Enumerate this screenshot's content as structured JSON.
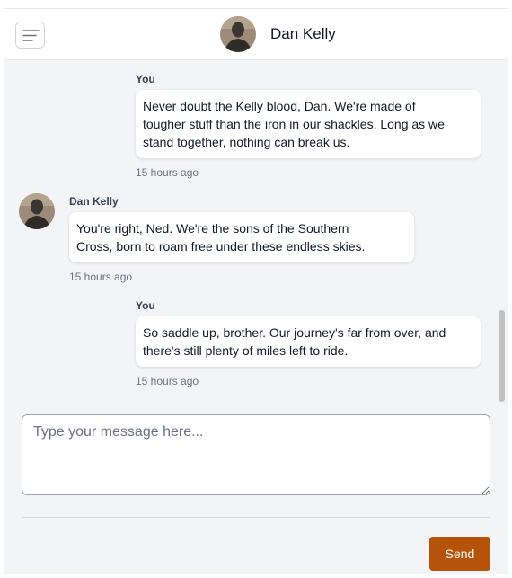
{
  "header": {
    "menu_icon": "menu-icon",
    "contact_name": "Dan Kelly"
  },
  "messages": [
    {
      "sender": "You",
      "text_lines": [
        "Never doubt the Kelly blood, Dan. We're made of",
        "tougher stuff than the iron in our shackles. Long as we",
        "stand together, nothing can break us."
      ],
      "time": "15 hours ago"
    },
    {
      "sender": "Dan Kelly",
      "text_lines": [
        "You're right, Ned. We're the sons of the Southern",
        "Cross, born to roam free under these endless skies."
      ],
      "time": "15 hours ago"
    },
    {
      "sender": "You",
      "text_lines": [
        "So saddle up, brother. Our journey's far from over, and",
        "there's still plenty of miles left to ride."
      ],
      "time": "15 hours ago"
    }
  ],
  "composer": {
    "placeholder": "Type your message here...",
    "value": "",
    "send_label": "Send"
  },
  "colors": {
    "send_button": "#b45309",
    "background": "#f3f4f6"
  }
}
